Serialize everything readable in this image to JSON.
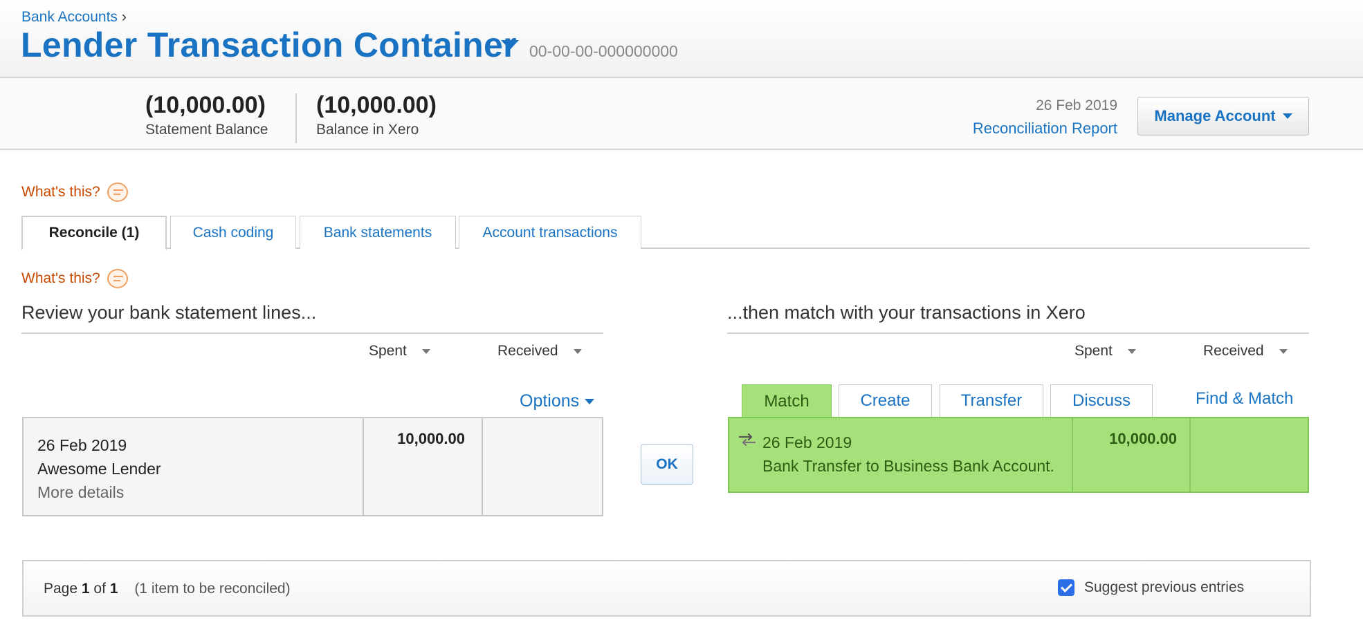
{
  "header": {
    "breadcrumb": "Bank Accounts",
    "breadcrumb_separator": "›",
    "title": "Lender Transaction Container",
    "account_number": "00-00-00-000000000"
  },
  "balances": {
    "statement_amount": "(10,000.00)",
    "statement_label": "Statement Balance",
    "xero_amount": "(10,000.00)",
    "xero_label": "Balance in Xero",
    "date": "26 Feb 2019",
    "reconciliation_report": "Reconciliation Report",
    "manage_account": "Manage Account"
  },
  "whats_this": "What's this?",
  "tabs": [
    {
      "label": "Reconcile (1)",
      "active": true
    },
    {
      "label": "Cash coding",
      "active": false
    },
    {
      "label": "Bank statements",
      "active": false
    },
    {
      "label": "Account transactions",
      "active": false
    }
  ],
  "left": {
    "heading": "Review your bank statement lines...",
    "spent": "Spent",
    "received": "Received",
    "options": "Options",
    "line": {
      "date": "26 Feb 2019",
      "payee": "Awesome Lender",
      "more": "More details",
      "spent": "10,000.00",
      "received": ""
    }
  },
  "ok_button": "OK",
  "right": {
    "heading": "...then match with your transactions in Xero",
    "spent": "Spent",
    "received": "Received",
    "tabs": [
      "Match",
      "Create",
      "Transfer",
      "Discuss"
    ],
    "find_match": "Find & Match",
    "match": {
      "date": "26 Feb 2019",
      "description": "Bank Transfer to Business Bank Account.",
      "spent": "10,000.00",
      "received": ""
    }
  },
  "footer": {
    "page_word": "Page",
    "page_current": "1",
    "of_word": "of",
    "page_total": "1",
    "reconcile_count": "(1 item to be reconciled)",
    "suggest_label": "Suggest previous entries",
    "suggest_checked": true
  },
  "colors": {
    "link": "#1a73c2",
    "warning": "#c84a00",
    "match_green": "#a6e07a",
    "checkbox": "#2b6ee8"
  }
}
